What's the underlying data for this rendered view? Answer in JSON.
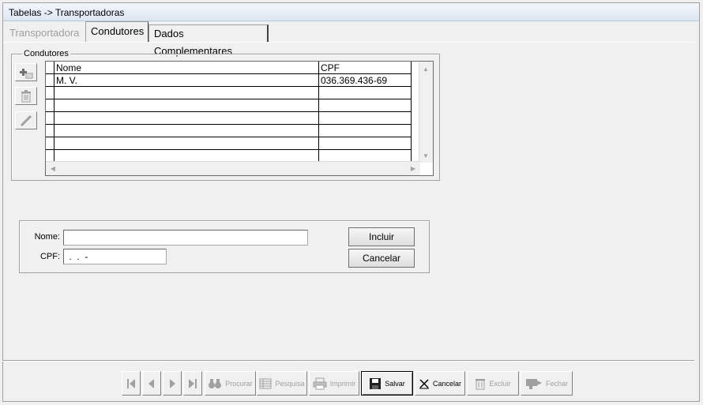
{
  "window": {
    "title": "Tabelas -> Transportadoras"
  },
  "tabs": [
    {
      "label": "Transportadora",
      "state": "disabled"
    },
    {
      "label": "Condutores",
      "state": "active"
    },
    {
      "label": "Dados Complementares",
      "state": "normal"
    }
  ],
  "condutores": {
    "group_label": "Condutores",
    "side_buttons": [
      "add-icon",
      "trash-icon",
      "pencil-icon"
    ],
    "grid": {
      "columns": [
        "Nome",
        "CPF"
      ],
      "rows": [
        [
          "M. V.",
          "036.369.436-69"
        ],
        [
          "",
          ""
        ],
        [
          "",
          ""
        ],
        [
          "",
          ""
        ],
        [
          "",
          ""
        ],
        [
          "",
          ""
        ],
        [
          "",
          ""
        ]
      ]
    }
  },
  "form": {
    "nome_label": "Nome:",
    "nome_value": "",
    "cpf_label": "CPF:",
    "cpf_value": " .  .  -",
    "incluir_label": "Incluir",
    "cancelar_label": "Cancelar"
  },
  "toolbar": {
    "procurar": "Procurar",
    "pesquisa": "Pesquisa",
    "imprimir": "Imprimir",
    "salvar": "Salvar",
    "cancelar": "Cancelar",
    "excluir": "Excluir",
    "fechar": "Fechar"
  }
}
